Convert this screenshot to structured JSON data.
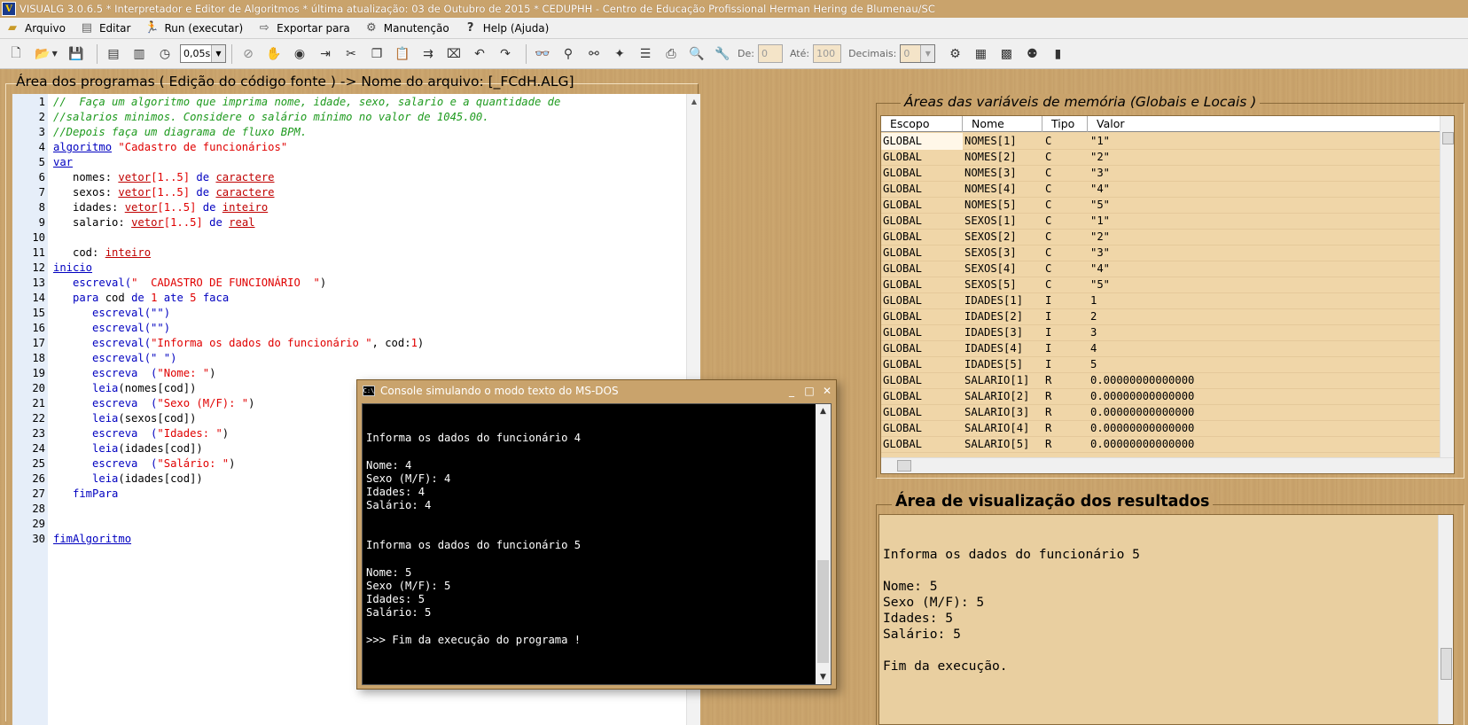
{
  "window": {
    "title": "VISUALG 3.0.6.5 * Interpretador e Editor de Algoritmos * última atualização: 03 de Outubro de 2015 * CEDUPHH - Centro de Educação Profissional Herman Hering de Blumenau/SC"
  },
  "menu": {
    "arquivo": "Arquivo",
    "editar": "Editar",
    "run": "Run (executar)",
    "exportar": "Exportar para",
    "manutencao": "Manutenção",
    "help": "Help (Ajuda)"
  },
  "toolbar": {
    "speed_value": "0,05s",
    "de_label": "De:",
    "de_value": "0",
    "ate_label": "Até:",
    "ate_value": "100",
    "decimais_label": "Decimais:",
    "decimais_value": "0"
  },
  "editor": {
    "header": "Área dos programas ( Edição do código fonte ) -> Nome do arquivo: [_FCdH.ALG]",
    "line_numbers": [
      "1",
      "2",
      "3",
      "4",
      "5",
      "6",
      "7",
      "8",
      "9",
      "10",
      "11",
      "12",
      "13",
      "14",
      "15",
      "16",
      "17",
      "18",
      "19",
      "20",
      "21",
      "22",
      "23",
      "24",
      "25",
      "26",
      "27",
      "28",
      "29",
      "30"
    ],
    "code": {
      "l1": "//  Faça um algoritmo que imprima nome, idade, sexo, salario e a quantidade de",
      "l2": "//salarios minimos. Considere o salário mínimo no valor de 1045.00.",
      "l3": "//Depois faça um diagrama de fluxo BPM.",
      "l4_kw": "algoritmo",
      "l4_str": "\"Cadastro de funcionários\"",
      "l5_kw": "var",
      "l6_id": "   nomes: ",
      "l6_kw": "vetor",
      "l6_rng": "[1..5]",
      "l6_de": " de ",
      "l6_ty": "caractere",
      "l7_id": "   sexos: ",
      "l7_kw": "vetor",
      "l7_rng": "[1..5]",
      "l7_de": " de ",
      "l7_ty": "caractere",
      "l8_id": "   idades: ",
      "l8_kw": "vetor",
      "l8_rng": "[1..5]",
      "l8_de": " de ",
      "l8_ty": "inteiro",
      "l9_id": "   salario: ",
      "l9_kw": "vetor",
      "l9_rng": "[1..5]",
      "l9_de": " de ",
      "l9_ty": "real",
      "l11_id": "   cod: ",
      "l11_ty": "inteiro",
      "l12_kw": "inicio",
      "l13_fn": "   escreval(",
      "l13_str": "\"  CADASTRO DE FUNCIONÁRIO  \"",
      "l13_end": ")",
      "l14_a": "   para ",
      "l14_b": "cod ",
      "l14_c": "de ",
      "l14_d": "1 ",
      "l14_e": "ate ",
      "l14_f": "5 ",
      "l14_g": "faca",
      "l15": "      escreval(\"\")",
      "l16": "      escreval(\"\")",
      "l17_fn": "      escreval(",
      "l17_str": "\"Informa os dados do funcionário \"",
      "l17_mid": ", cod:",
      "l17_num": "1",
      "l17_end": ")",
      "l18": "      escreval(\" \")",
      "l19_fn": "      escreva  (",
      "l19_str": "\"Nome: \"",
      "l19_end": ")",
      "l20_fn": "      leia",
      "l20_rest": "(nomes[cod])",
      "l21_fn": "      escreva  (",
      "l21_str": "\"Sexo (M/F): \"",
      "l21_end": ")",
      "l22_fn": "      leia",
      "l22_rest": "(sexos[cod])",
      "l23_fn": "      escreva  (",
      "l23_str": "\"Idades: \"",
      "l23_end": ")",
      "l24_fn": "      leia",
      "l24_rest": "(idades[cod])",
      "l25_fn": "      escreva  (",
      "l25_str": "\"Salário: \"",
      "l25_end": ")",
      "l26_fn": "      leia",
      "l26_rest": "(idades[cod])",
      "l27": "   fimPara",
      "l30": "fimAlgoritmo"
    }
  },
  "variables": {
    "title": "Áreas das variáveis de memória (Globais e Locais )",
    "columns": [
      "Escopo",
      "Nome",
      "Tipo",
      "Valor"
    ],
    "rows": [
      [
        "GLOBAL",
        "NOMES[1]",
        "C",
        "\"1\""
      ],
      [
        "GLOBAL",
        "NOMES[2]",
        "C",
        "\"2\""
      ],
      [
        "GLOBAL",
        "NOMES[3]",
        "C",
        "\"3\""
      ],
      [
        "GLOBAL",
        "NOMES[4]",
        "C",
        "\"4\""
      ],
      [
        "GLOBAL",
        "NOMES[5]",
        "C",
        "\"5\""
      ],
      [
        "GLOBAL",
        "SEXOS[1]",
        "C",
        "\"1\""
      ],
      [
        "GLOBAL",
        "SEXOS[2]",
        "C",
        "\"2\""
      ],
      [
        "GLOBAL",
        "SEXOS[3]",
        "C",
        "\"3\""
      ],
      [
        "GLOBAL",
        "SEXOS[4]",
        "C",
        "\"4\""
      ],
      [
        "GLOBAL",
        "SEXOS[5]",
        "C",
        "\"5\""
      ],
      [
        "GLOBAL",
        "IDADES[1]",
        "I",
        "1"
      ],
      [
        "GLOBAL",
        "IDADES[2]",
        "I",
        "2"
      ],
      [
        "GLOBAL",
        "IDADES[3]",
        "I",
        "3"
      ],
      [
        "GLOBAL",
        "IDADES[4]",
        "I",
        "4"
      ],
      [
        "GLOBAL",
        "IDADES[5]",
        "I",
        "5"
      ],
      [
        "GLOBAL",
        "SALARIO[1]",
        "R",
        "0.00000000000000"
      ],
      [
        "GLOBAL",
        "SALARIO[2]",
        "R",
        "0.00000000000000"
      ],
      [
        "GLOBAL",
        "SALARIO[3]",
        "R",
        "0.00000000000000"
      ],
      [
        "GLOBAL",
        "SALARIO[4]",
        "R",
        "0.00000000000000"
      ],
      [
        "GLOBAL",
        "SALARIO[5]",
        "R",
        "0.00000000000000"
      ]
    ]
  },
  "results": {
    "title": "Área de visualização dos resultados",
    "lines": [
      "Informa os dados do funcionário 5",
      "",
      "Nome: 5",
      "Sexo (M/F): 5",
      "Idades: 5",
      "Salário: 5",
      "",
      "Fim da execução."
    ]
  },
  "console": {
    "title": "Console simulando o modo texto do MS-DOS",
    "lines": [
      "Informa os dados do funcionário 4",
      "",
      "Nome: 4",
      "Sexo (M/F): 4",
      "Idades: 4",
      "Salário: 4",
      "",
      "",
      "Informa os dados do funcionário 5",
      "",
      "Nome: 5",
      "Sexo (M/F): 5",
      "Idades: 5",
      "Salário: 5",
      "",
      ">>> Fim da execução do programa !"
    ]
  },
  "colors": {
    "background": "#c9a36c",
    "comment": "#1e9a1e",
    "keyword": "#0000c0",
    "string": "#e00000",
    "console_bg": "#000000",
    "vars_bg": "#f0d6a8"
  }
}
